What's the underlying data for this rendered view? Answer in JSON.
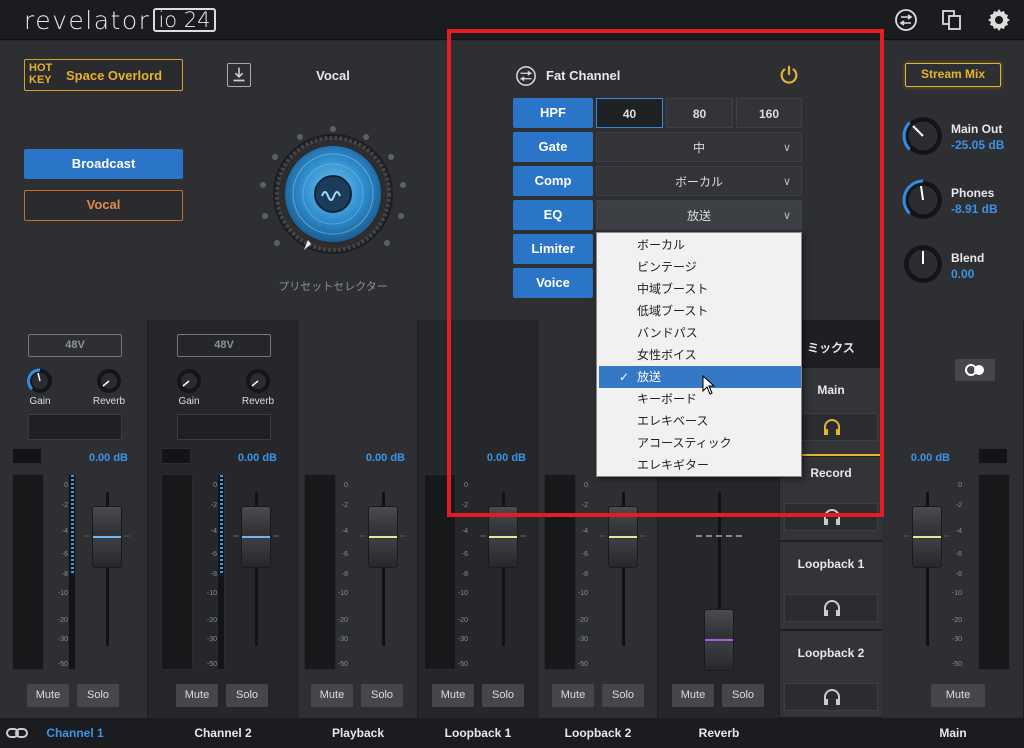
{
  "app": {
    "brand": "revelator",
    "model": "io 24"
  },
  "top_icons": [
    "mixer-settings-icon",
    "duplicate-icon",
    "gear-icon"
  ],
  "hotkey": {
    "badge": "HOT KEY",
    "badge_line1": "HOT",
    "badge_line2": "KEY",
    "preset": "Space Overlord"
  },
  "presets": {
    "broadcast": "Broadcast",
    "vocal": "Vocal"
  },
  "vocal_title": "Vocal",
  "preset_selector_label": "プリセットセレクター",
  "fat_channel": {
    "title": "Fat Channel",
    "hpf": {
      "label": "HPF",
      "options": [
        "40",
        "80",
        "160"
      ],
      "selected": "40"
    },
    "gate": {
      "label": "Gate",
      "value": "中"
    },
    "comp": {
      "label": "Comp",
      "value": "ボーカル"
    },
    "eq": {
      "label": "EQ",
      "value": "放送"
    },
    "limiter": {
      "label": "Limiter"
    },
    "voice": {
      "label": "Voice"
    },
    "eq_menu": {
      "items": [
        "ボーカル",
        "ビンテージ",
        "中域ブースト",
        "低域ブースト",
        "バンドパス",
        "女性ボイス",
        "放送",
        "キーボード",
        "エレキベース",
        "アコースティック",
        "エレキギター"
      ],
      "selected": "放送"
    }
  },
  "stream_mix": {
    "label": "Stream Mix",
    "main_out": {
      "label": "Main Out",
      "value": "-25.05 dB"
    },
    "phones": {
      "label": "Phones",
      "value": "-8.91 dB"
    },
    "blend": {
      "label": "Blend",
      "value": "0.00"
    }
  },
  "scale_ticks": [
    "0",
    "-2",
    "-4",
    "-6",
    "-8",
    "-10",
    "-20",
    "-30",
    "-50"
  ],
  "strips": [
    {
      "name": "Channel 1",
      "phantom": "48V",
      "gain": "Gain",
      "reverb": "Reverb",
      "db": "0.00 dB",
      "mute": "Mute",
      "solo": "Solo"
    },
    {
      "name": "Channel 2",
      "phantom": "48V",
      "gain": "Gain",
      "reverb": "Reverb",
      "db": "0.00 dB",
      "mute": "Mute",
      "solo": "Solo"
    },
    {
      "name": "Playback",
      "db": "0.00 dB",
      "mute": "Mute",
      "solo": "Solo"
    },
    {
      "name": "Loopback 1",
      "db": "0.00 dB",
      "mute": "Mute",
      "solo": "Solo"
    },
    {
      "name": "Loopback 2",
      "db": "",
      "mute": "Mute",
      "solo": "Solo"
    },
    {
      "name": "Reverb",
      "db": "",
      "mute": "Mute",
      "solo": "Solo"
    },
    {
      "name": "Main",
      "db": "0.00 dB",
      "mute": "Mute"
    }
  ],
  "mix_panel": {
    "title": "ミックス",
    "main": "Main",
    "record": "Record",
    "loopback1": "Loopback 1",
    "loopback2": "Loopback 2"
  },
  "colors": {
    "accent": "#2a75c7",
    "value_blue": "#3c94e4",
    "hotkey_gold": "#e5b22c",
    "vocal_orange": "#e28a47",
    "highlight_red": "#e41d25"
  }
}
